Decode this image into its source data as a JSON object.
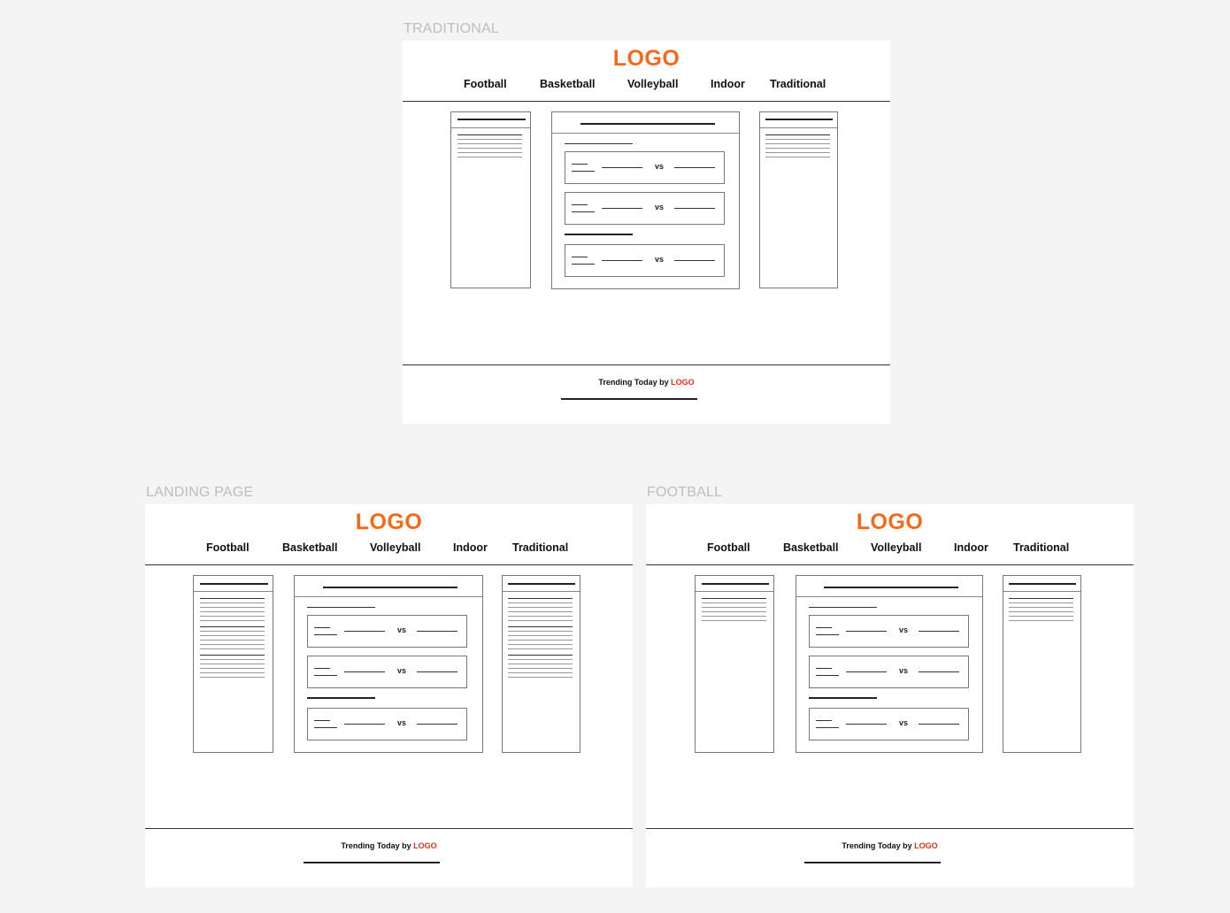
{
  "frames": [
    {
      "label": "TRADITIONAL"
    },
    {
      "label": "LANDING PAGE"
    },
    {
      "label": "FOOTBALL"
    }
  ],
  "header": {
    "logo": "LOGO",
    "nav": [
      "Football",
      "Basketball",
      "Volleyball",
      "Indoor",
      "Traditional"
    ]
  },
  "match_separator": "vs",
  "footer": {
    "text": "Trending  Today by ",
    "logo": "LOGO"
  },
  "colors": {
    "logo": "#f36a1d",
    "footer_logo": "#e3311d",
    "canvas": "#f4f4f4",
    "frame": "#ffffff"
  }
}
